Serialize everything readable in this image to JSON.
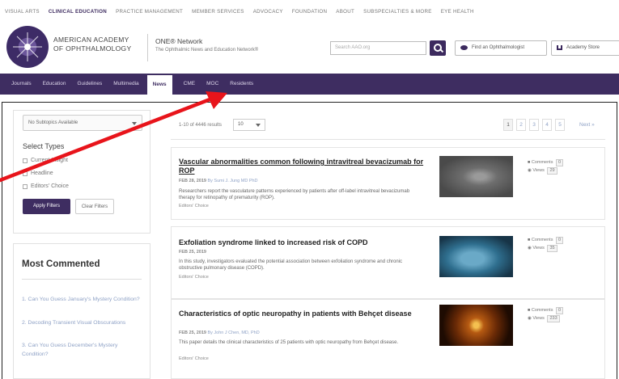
{
  "topnav": [
    "Visual Arts",
    "Clinical Education",
    "Practice Management",
    "Member Services",
    "Advocacy",
    "Foundation",
    "About",
    "Subspecialties & More",
    "Eye Health"
  ],
  "topnav_active": "Clinical Education",
  "logo": {
    "line1": "AMERICAN ACADEMY",
    "line2": "OF OPHTHALMOLOGY"
  },
  "network": {
    "title": "ONE® Network",
    "subtitle": "The Ophthalmic News and Education Network®"
  },
  "search": {
    "placeholder": "Search AAO.org"
  },
  "header_buttons": {
    "find": "Find an Ophthalmologist",
    "store": "Academy Store"
  },
  "mainnav": [
    "Journals",
    "Education",
    "Guidelines",
    "Multimedia",
    "News",
    "CME",
    "MOC",
    "Residents"
  ],
  "mainnav_active": "News",
  "filters": {
    "subspecialty": "No Subtopics Available",
    "select_types": "Select Types",
    "types": [
      "Current Insight",
      "Headline",
      "Editors' Choice"
    ],
    "apply": "Apply Filters",
    "clear": "Clear Filters"
  },
  "most_commented": {
    "title": "Most Commented",
    "items": [
      "1. Can You Guess January's Mystery Condition?",
      "2. Decoding Transient Visual Obscurations",
      "3. Can You Guess December's Mystery Condition?"
    ]
  },
  "results": {
    "count": "1-10 of 4446 results",
    "per_page": "10",
    "pages": [
      "1",
      "2",
      "3",
      "4",
      "5"
    ],
    "current_page": "1",
    "next": "Next »"
  },
  "articles": [
    {
      "title": "Vascular abnormalities common following intravitreal bevacizumab for ROP",
      "date": "FEB 28, 2019",
      "author": "By Sumi J. Jung MD PhD",
      "description": "Researchers report the vasculature patterns experienced by patients after off-label intravitreal bevacizumab therapy for retinopathy of prematurity (ROP).",
      "badge": "Editors' Choice",
      "comments": "0",
      "views": "29"
    },
    {
      "title": "Exfoliation syndrome linked to increased risk of COPD",
      "date": "FEB 25, 2019",
      "author": "",
      "description": "In this study, investigators evaluated the potential association between exfoliation syndrome and chronic obstructive pulmonary disease (COPD).",
      "badge": "Editors' Choice",
      "comments": "0",
      "views": "35"
    },
    {
      "title": "Characteristics of optic neuropathy in patients with Behçet disease",
      "date": "FEB 25, 2019",
      "author": "By John J Chen, MD, PhD",
      "description": "This paper details the clinical characteristics of 25 patients with optic neuropathy from Behçet disease.",
      "badge": "Editors' Choice",
      "comments": "0",
      "views": "233"
    }
  ],
  "meta_labels": {
    "comments": "Comments",
    "views": "Views"
  },
  "colors": {
    "brand_purple": "#3e2d61",
    "link_blue": "#8fa2c6",
    "annotation_red": "#e8141b"
  }
}
